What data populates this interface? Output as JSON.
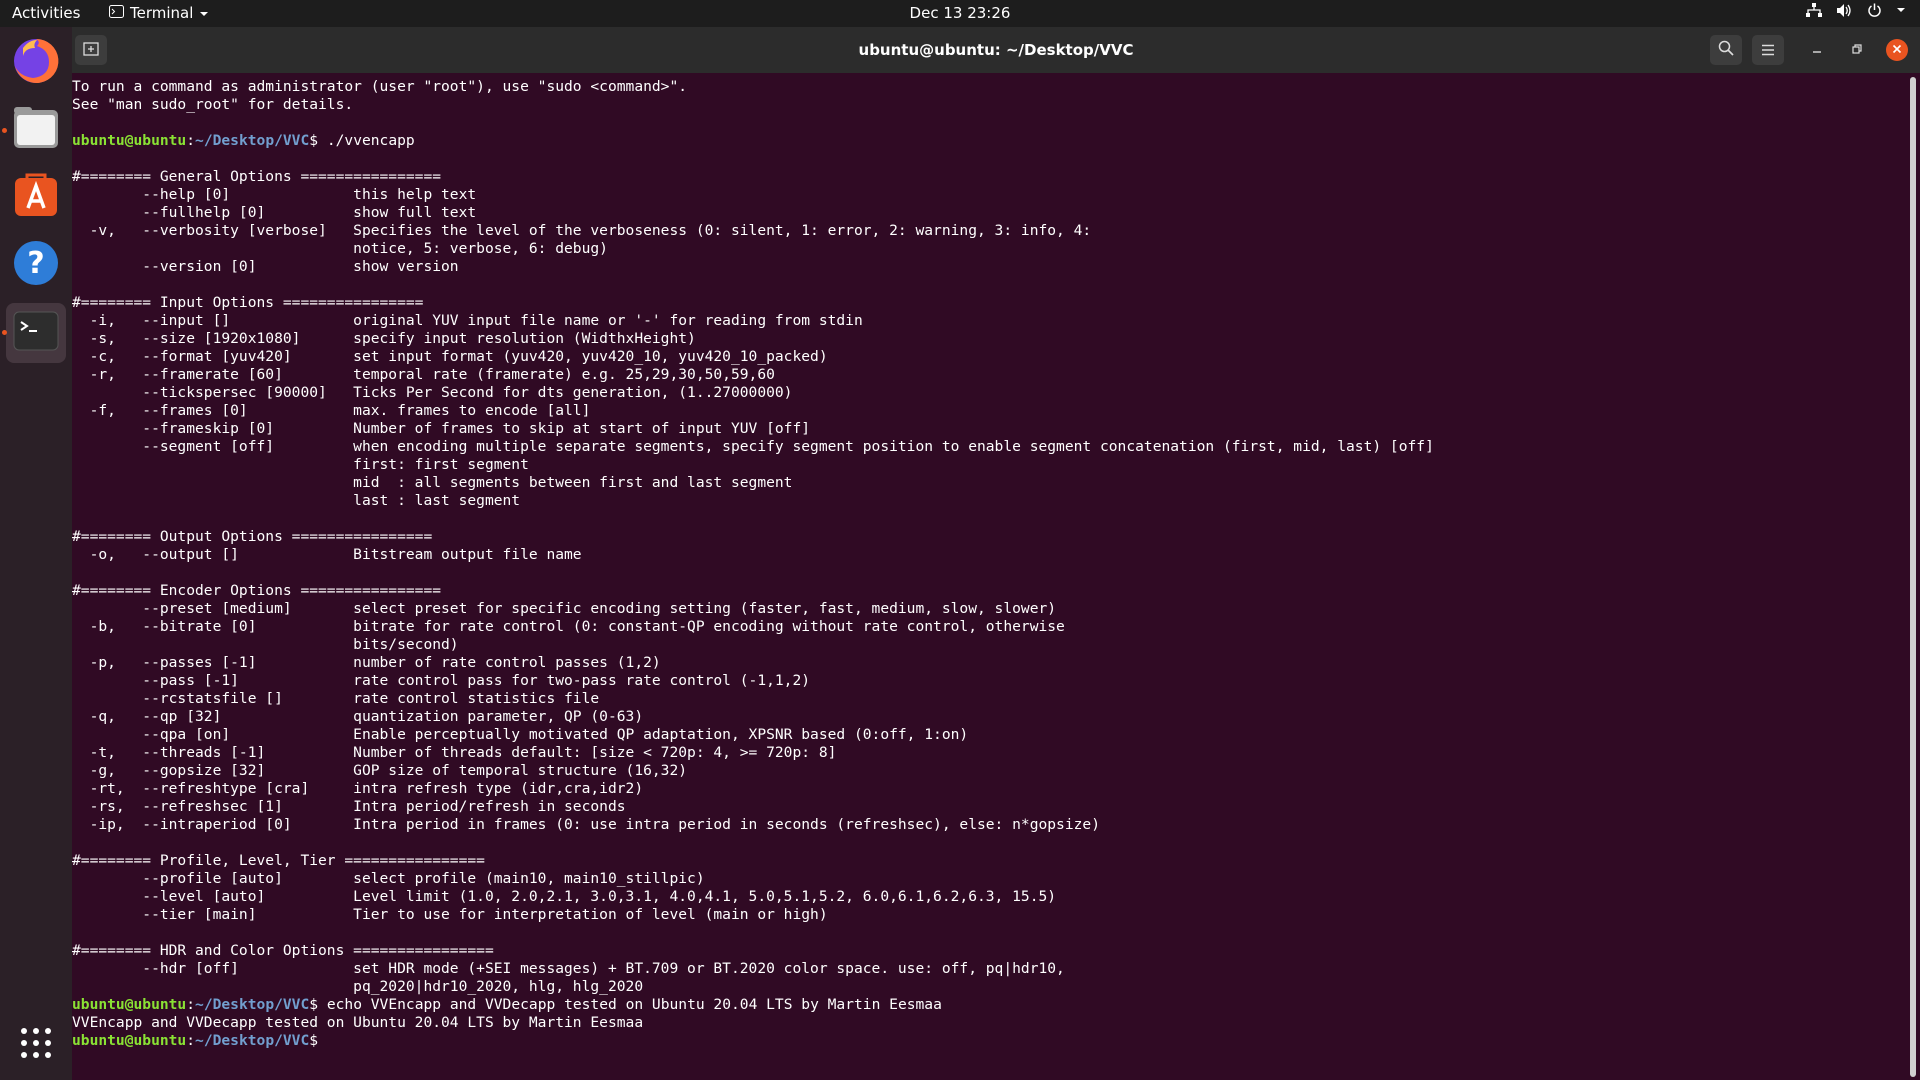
{
  "topbar": {
    "activities": "Activities",
    "app_menu": "Terminal",
    "clock": "Dec 13  23:26"
  },
  "dock": {
    "items": [
      {
        "name": "firefox",
        "active": false,
        "running": false
      },
      {
        "name": "files",
        "active": false,
        "running": true
      },
      {
        "name": "ubuntu-software",
        "active": false,
        "running": false
      },
      {
        "name": "help",
        "active": false,
        "running": false
      },
      {
        "name": "terminal",
        "active": true,
        "running": true
      }
    ],
    "show_apps": "show-applications"
  },
  "window": {
    "title": "ubuntu@ubuntu: ~/Desktop/VVC"
  },
  "terminal": {
    "lines": [
      {
        "text": "To run a command as administrator (user \"root\"), use \"sudo <command>\"."
      },
      {
        "text": "See \"man sudo_root\" for details."
      },
      {
        "text": ""
      },
      {
        "user": "ubuntu@ubuntu",
        "path": "~/Desktop/VVC",
        "cmd": "$ ./vvencapp"
      },
      {
        "text": ""
      },
      {
        "text": "#======== General Options ================"
      },
      {
        "text": "        --help [0]              this help text"
      },
      {
        "text": "        --fullhelp [0]          show full text"
      },
      {
        "text": "  -v,   --verbosity [verbose]   Specifies the level of the verboseness (0: silent, 1: error, 2: warning, 3: info, 4:"
      },
      {
        "text": "                                notice, 5: verbose, 6: debug)"
      },
      {
        "text": "        --version [0]           show version"
      },
      {
        "text": ""
      },
      {
        "text": "#======== Input Options ================"
      },
      {
        "text": "  -i,   --input []              original YUV input file name or '-' for reading from stdin"
      },
      {
        "text": "  -s,   --size [1920x1080]      specify input resolution (WidthxHeight)"
      },
      {
        "text": "  -c,   --format [yuv420]       set input format (yuv420, yuv420_10, yuv420_10_packed)"
      },
      {
        "text": "  -r,   --framerate [60]        temporal rate (framerate) e.g. 25,29,30,50,59,60"
      },
      {
        "text": "        --tickspersec [90000]   Ticks Per Second for dts generation, (1..27000000)"
      },
      {
        "text": "  -f,   --frames [0]            max. frames to encode [all]"
      },
      {
        "text": "        --frameskip [0]         Number of frames to skip at start of input YUV [off]"
      },
      {
        "text": "        --segment [off]         when encoding multiple separate segments, specify segment position to enable segment concatenation (first, mid, last) [off]"
      },
      {
        "text": "                                first: first segment"
      },
      {
        "text": "                                mid  : all segments between first and last segment"
      },
      {
        "text": "                                last : last segment"
      },
      {
        "text": ""
      },
      {
        "text": "#======== Output Options ================"
      },
      {
        "text": "  -o,   --output []             Bitstream output file name"
      },
      {
        "text": ""
      },
      {
        "text": "#======== Encoder Options ================"
      },
      {
        "text": "        --preset [medium]       select preset for specific encoding setting (faster, fast, medium, slow, slower)"
      },
      {
        "text": "  -b,   --bitrate [0]           bitrate for rate control (0: constant-QP encoding without rate control, otherwise"
      },
      {
        "text": "                                bits/second)"
      },
      {
        "text": "  -p,   --passes [-1]           number of rate control passes (1,2)"
      },
      {
        "text": "        --pass [-1]             rate control pass for two-pass rate control (-1,1,2)"
      },
      {
        "text": "        --rcstatsfile []        rate control statistics file"
      },
      {
        "text": "  -q,   --qp [32]               quantization parameter, QP (0-63)"
      },
      {
        "text": "        --qpa [on]              Enable perceptually motivated QP adaptation, XPSNR based (0:off, 1:on)"
      },
      {
        "text": "  -t,   --threads [-1]          Number of threads default: [size < 720p: 4, >= 720p: 8]"
      },
      {
        "text": "  -g,   --gopsize [32]          GOP size of temporal structure (16,32)"
      },
      {
        "text": "  -rt,  --refreshtype [cra]     intra refresh type (idr,cra,idr2)"
      },
      {
        "text": "  -rs,  --refreshsec [1]        Intra period/refresh in seconds"
      },
      {
        "text": "  -ip,  --intraperiod [0]       Intra period in frames (0: use intra period in seconds (refreshsec), else: n*gopsize)"
      },
      {
        "text": ""
      },
      {
        "text": "#======== Profile, Level, Tier ================"
      },
      {
        "text": "        --profile [auto]        select profile (main10, main10_stillpic)"
      },
      {
        "text": "        --level [auto]          Level limit (1.0, 2.0,2.1, 3.0,3.1, 4.0,4.1, 5.0,5.1,5.2, 6.0,6.1,6.2,6.3, 15.5)"
      },
      {
        "text": "        --tier [main]           Tier to use for interpretation of level (main or high)"
      },
      {
        "text": ""
      },
      {
        "text": "#======== HDR and Color Options ================"
      },
      {
        "text": "        --hdr [off]             set HDR mode (+SEI messages) + BT.709 or BT.2020 color space. use: off, pq|hdr10,"
      },
      {
        "text": "                                pq_2020|hdr10_2020, hlg, hlg_2020"
      },
      {
        "user": "ubuntu@ubuntu",
        "path": "~/Desktop/VVC",
        "cmd": "$ echo VVEncapp and VVDecapp tested on Ubuntu 20.04 LTS by Martin Eesmaa"
      },
      {
        "text": "VVEncapp and VVDecapp tested on Ubuntu 20.04 LTS by Martin Eesmaa"
      },
      {
        "user": "ubuntu@ubuntu",
        "path": "~/Desktop/VVC",
        "cmd": "$ "
      }
    ]
  }
}
